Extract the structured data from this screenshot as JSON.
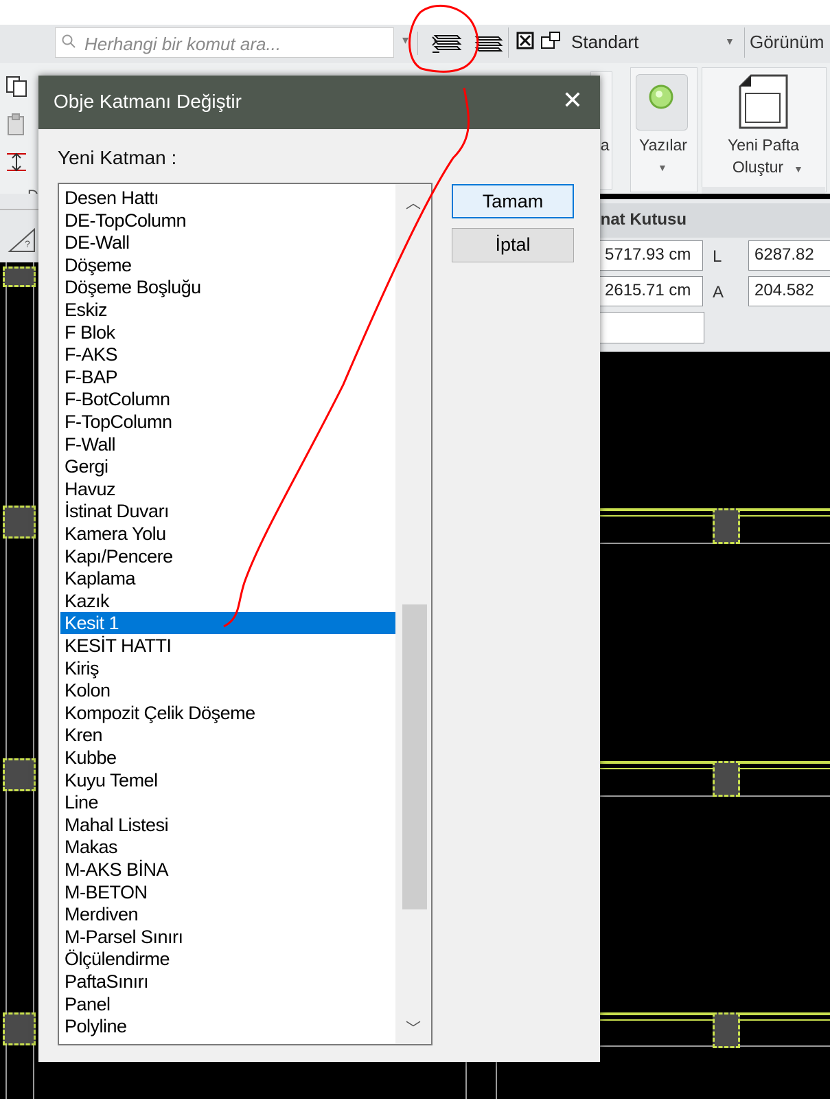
{
  "toolbar": {
    "search_placeholder": "Herhangi bir komut ara...",
    "style_combo_value": "Standart",
    "view_label": "Görünüm"
  },
  "ribbon": {
    "partial_button_label": "na",
    "texts_button_label": "Yazılar",
    "new_sheet_line1": "Yeni Pafta",
    "new_sheet_line2": "Oluştur",
    "left_label": "D"
  },
  "coord_panel": {
    "title": "inat Kutusu",
    "x_value": "5717.93 cm",
    "y_value": "2615.71 cm",
    "l_label": "L",
    "a_label": "A",
    "l_value": "6287.82",
    "a_value": "204.582"
  },
  "dialog": {
    "title": "Obje Katmanı Değiştir",
    "close_glyph": "✕",
    "list_label": "Yeni Katman :",
    "ok_label": "Tamam",
    "cancel_label": "İptal",
    "selected_layer": "Kesit  1",
    "layers": [
      "Desen Hattı",
      "DE-TopColumn",
      "DE-Wall",
      "Döşeme",
      "Döşeme Boşluğu",
      "Eskiz",
      "F Blok",
      "F-AKS",
      "F-BAP",
      "F-BotColumn",
      "F-TopColumn",
      "F-Wall",
      "Gergi",
      "Havuz",
      "İstinat Duvarı",
      "Kamera Yolu",
      "Kapı/Pencere",
      "Kaplama",
      "Kazık",
      "Kesit  1",
      "KESİT HATTI",
      "Kiriş",
      "Kolon",
      "Kompozit Çelik Döşeme",
      "Kren",
      "Kubbe",
      "Kuyu Temel",
      "Line",
      "Mahal Listesi",
      "Makas",
      "M-AKS BİNA",
      "M-BETON",
      "Merdiven",
      "M-Parsel Sınırı",
      "Ölçülendirme",
      "PaftaSınırı",
      "Panel",
      "Polyline"
    ]
  },
  "colors": {
    "dialog_title_bg": "#4f584f",
    "selection_bg": "#0078d7",
    "annotation_red": "#ff0000",
    "cad_lime": "#c9e04e"
  },
  "icons": [
    "search-icon",
    "layer-change-icon",
    "layer-list-icon",
    "checkbox-x-icon",
    "lock-window-icon",
    "chevron-up-icon",
    "chevron-down-icon",
    "close-icon",
    "page-icon",
    "green-dot-icon",
    "copy-icon",
    "paste-icon",
    "section-icon",
    "angle-icon"
  ]
}
